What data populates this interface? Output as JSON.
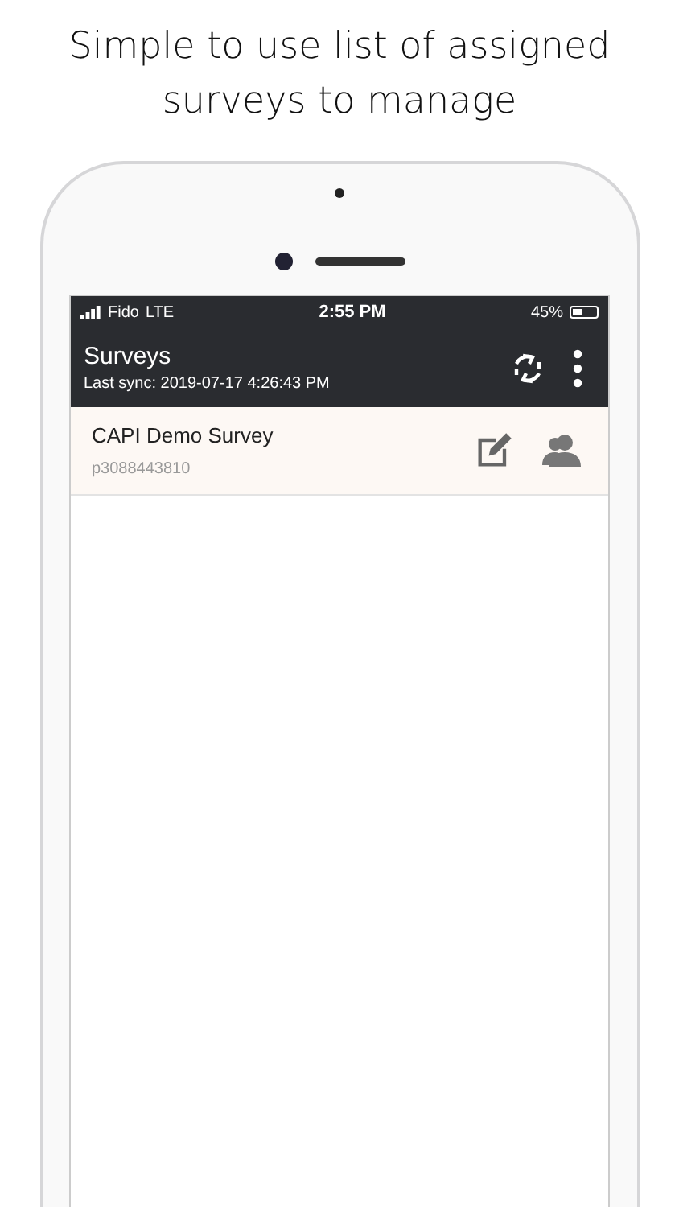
{
  "caption": "Simple to use list of assigned surveys to manage",
  "status_bar": {
    "carrier": "Fido",
    "network": "LTE",
    "time": "2:55 PM",
    "battery": "45%"
  },
  "toolbar": {
    "title": "Surveys",
    "subtitle": "Last sync: 2019-07-17 4:26:43 PM"
  },
  "surveys": [
    {
      "name": "CAPI Demo Survey",
      "id": "p3088443810"
    }
  ]
}
